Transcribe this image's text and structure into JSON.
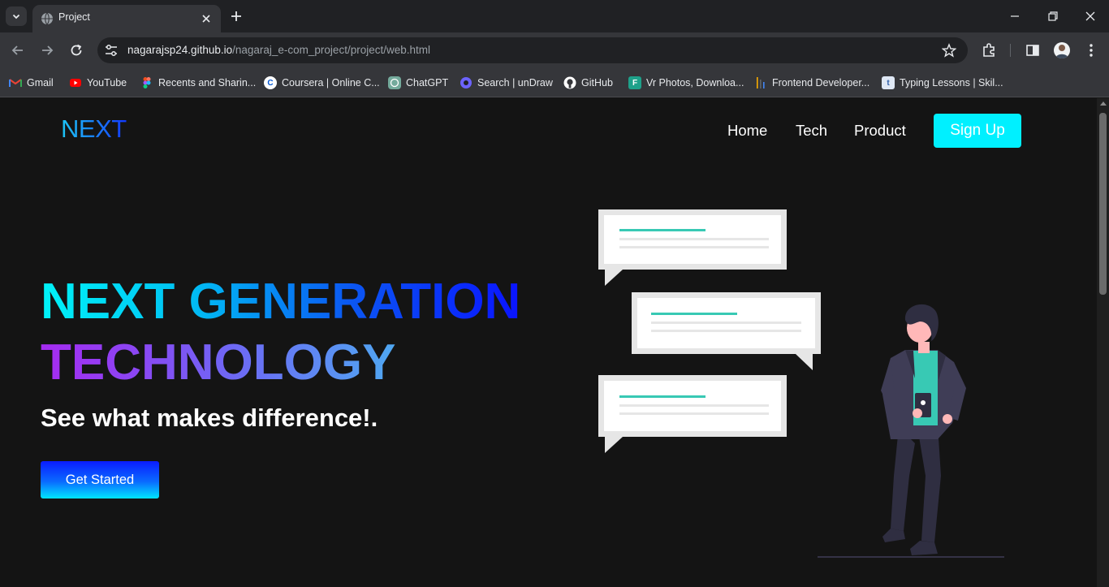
{
  "browser": {
    "tab_title": "Project",
    "url_host": "nagarajsp24.github.io",
    "url_path": "/nagaraj_e-com_project/project/web.html",
    "bookmarks": [
      {
        "label": "Gmail",
        "icon": "gmail-icon"
      },
      {
        "label": "YouTube",
        "icon": "youtube-icon"
      },
      {
        "label": "Recents and Sharin...",
        "icon": "figma-icon"
      },
      {
        "label": "Coursera | Online C...",
        "icon": "coursera-icon"
      },
      {
        "label": "ChatGPT",
        "icon": "chatgpt-icon"
      },
      {
        "label": "Search | unDraw",
        "icon": "undraw-icon"
      },
      {
        "label": "GitHub",
        "icon": "github-icon"
      },
      {
        "label": "Vr Photos, Downloa...",
        "icon": "freepik-icon"
      },
      {
        "label": "Frontend Developer...",
        "icon": "indeed-icon"
      },
      {
        "label": "Typing Lessons | Skil...",
        "icon": "typing-icon"
      }
    ]
  },
  "site": {
    "logo": "NEXT",
    "nav": {
      "home": "Home",
      "tech": "Tech",
      "product": "Product",
      "signup": "Sign Up"
    },
    "hero": {
      "line1": "NEXT GENERATION",
      "line2": "TECHNOLOGY",
      "subtitle": "See what makes difference!.",
      "cta": "Get Started"
    }
  },
  "colors": {
    "page_background": "#141414",
    "signup_button": "#00f0ff",
    "chat_accent": "#38c9b4",
    "person_shirt": "#38c9b4",
    "person_suit": "#2f2e41"
  }
}
